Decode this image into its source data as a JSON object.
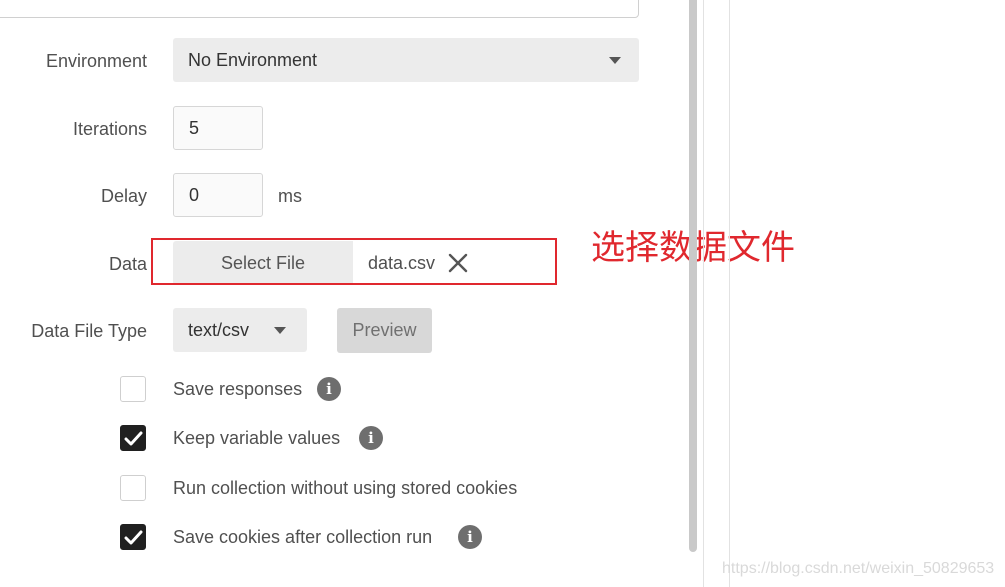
{
  "form": {
    "environment": {
      "label": "Environment",
      "selected": "No Environment"
    },
    "iterations": {
      "label": "Iterations",
      "value": "5"
    },
    "delay": {
      "label": "Delay",
      "value": "0",
      "unit": "ms"
    },
    "data": {
      "label": "Data",
      "select_button": "Select File",
      "file_name": "data.csv",
      "clear_icon": "close-icon"
    },
    "data_file_type": {
      "label": "Data File Type",
      "selected": "text/csv",
      "preview_button": "Preview"
    },
    "options": [
      {
        "label": "Save responses",
        "checked": false,
        "has_info": true
      },
      {
        "label": "Keep variable values",
        "checked": true,
        "has_info": true
      },
      {
        "label": "Run collection without using stored cookies",
        "checked": false,
        "has_info": false
      },
      {
        "label": "Save cookies after collection run",
        "checked": true,
        "has_info": true
      }
    ]
  },
  "annotation": {
    "text": "选择数据文件",
    "color": "#e0282e"
  },
  "watermark": "https://blog.csdn.net/weixin_50829653"
}
